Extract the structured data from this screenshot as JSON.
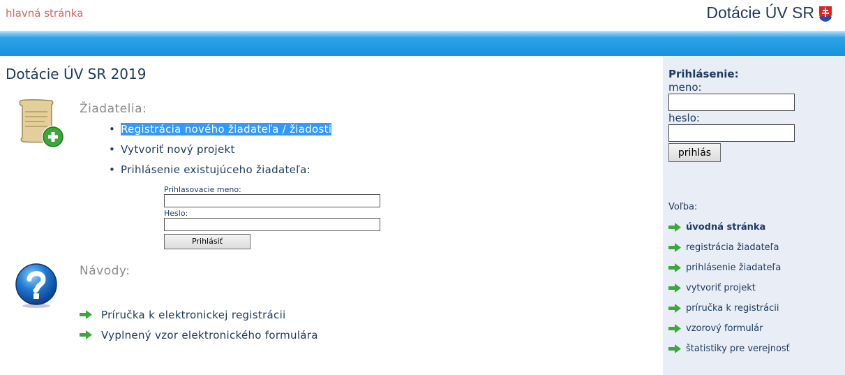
{
  "header": {
    "home_link": "hlavná stránka",
    "site_title": "Dotácie ÚV SR"
  },
  "main": {
    "page_title": "Dotácie ÚV SR 2019",
    "applicants": {
      "title": "Žiadatelia:",
      "items": [
        "Registrácia nového žiadateľa / žiadosti",
        "Vytvoriť nový projekt",
        "Prihlásenie existujúceho žiadateľa:"
      ]
    },
    "login_form": {
      "username_label": "Prihlasovacie meno:",
      "username_value": "",
      "password_label": "Heslo:",
      "password_value": "",
      "submit_label": "Prihlásiť"
    },
    "guides": {
      "title": "Návody:",
      "items": [
        "Príručka k elektronickej registrácii",
        "Vyplnený vzor elektronického formulára"
      ]
    }
  },
  "sidebar": {
    "login_title": "Prihlásenie:",
    "username_label": "meno:",
    "username_value": "",
    "password_label": "heslo:",
    "password_value": "",
    "submit_label": "prihlás",
    "menu_label": "Voľba:",
    "menu_items": [
      "úvodná stránka",
      "registrácia žiadateľa",
      "prihlásenie žiadateľa",
      "vytvoriť projekt",
      "príručka k registrácii",
      "vzorový formulár",
      "štatistiky pre verejnosť"
    ]
  },
  "colors": {
    "link": "#1f3a60",
    "home_link": "#e06060",
    "blue_bar": "#1b96e0",
    "selection": "#3399ff",
    "arrow_green": "#3aa83a",
    "sidebar_bg": "#e9eef6"
  },
  "icons": [
    "slovak-emblem-icon",
    "scroll-add-icon",
    "help-question-icon",
    "green-arrow-icon"
  ]
}
